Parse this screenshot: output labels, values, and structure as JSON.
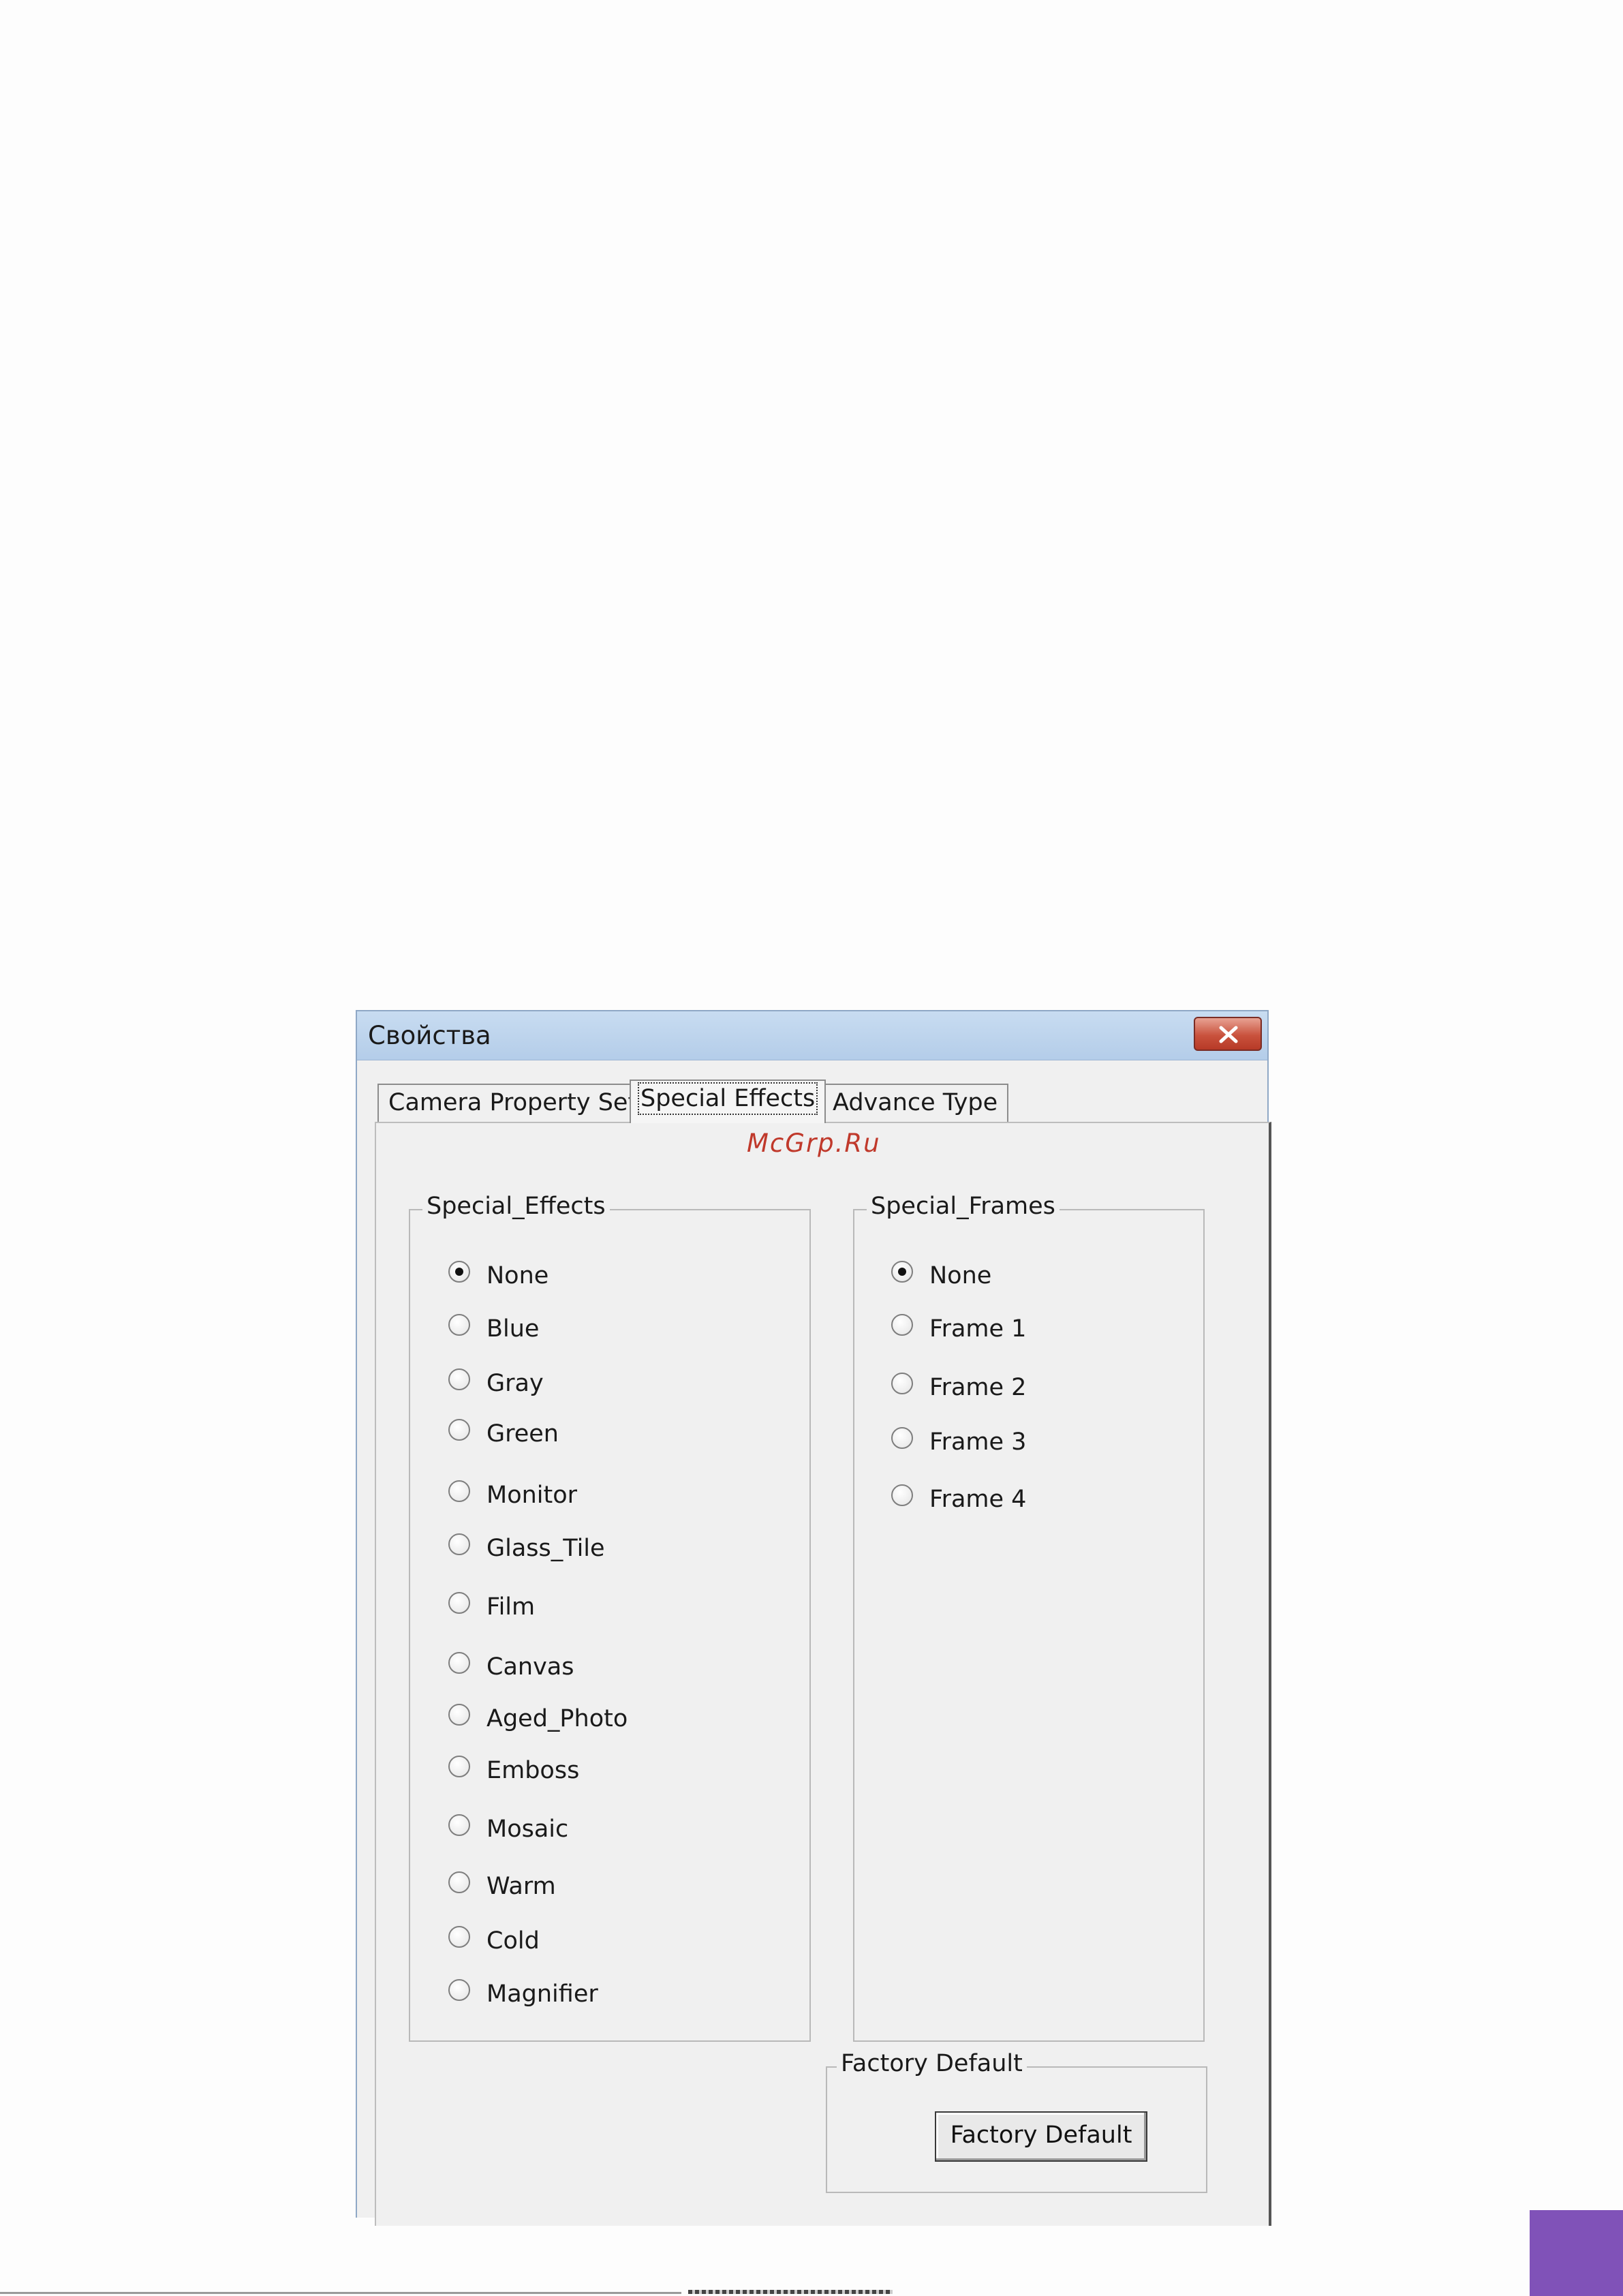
{
  "window": {
    "title": "Свойства"
  },
  "tabs": [
    {
      "label": "Camera Property Set",
      "active": false
    },
    {
      "label": "Special Effects",
      "active": true
    },
    {
      "label": "Advance Type",
      "active": false
    }
  ],
  "watermark": "McGrp.Ru",
  "special_effects": {
    "legend": "Special_Effects",
    "options": [
      {
        "label": "None",
        "selected": true
      },
      {
        "label": "Blue",
        "selected": false
      },
      {
        "label": "Gray",
        "selected": false
      },
      {
        "label": "Green",
        "selected": false
      },
      {
        "label": "Monitor",
        "selected": false
      },
      {
        "label": "Glass_Tile",
        "selected": false
      },
      {
        "label": "Film",
        "selected": false
      },
      {
        "label": "Canvas",
        "selected": false
      },
      {
        "label": "Aged_Photo",
        "selected": false
      },
      {
        "label": "Emboss",
        "selected": false
      },
      {
        "label": "Mosaic",
        "selected": false
      },
      {
        "label": "Warm",
        "selected": false
      },
      {
        "label": "Cold",
        "selected": false
      },
      {
        "label": "Magnifier",
        "selected": false
      }
    ]
  },
  "special_frames": {
    "legend": "Special_Frames",
    "options": [
      {
        "label": "None",
        "selected": true
      },
      {
        "label": "Frame 1",
        "selected": false
      },
      {
        "label": "Frame 2",
        "selected": false
      },
      {
        "label": "Frame 3",
        "selected": false
      },
      {
        "label": "Frame 4",
        "selected": false
      }
    ]
  },
  "factory_default": {
    "legend": "Factory Default",
    "button_label": "Factory Default"
  },
  "colors": {
    "watermark": "#c0392b",
    "close_button": "#c9523d",
    "corner_accent": "#8052b8"
  },
  "icons": {
    "close": "close-icon"
  }
}
